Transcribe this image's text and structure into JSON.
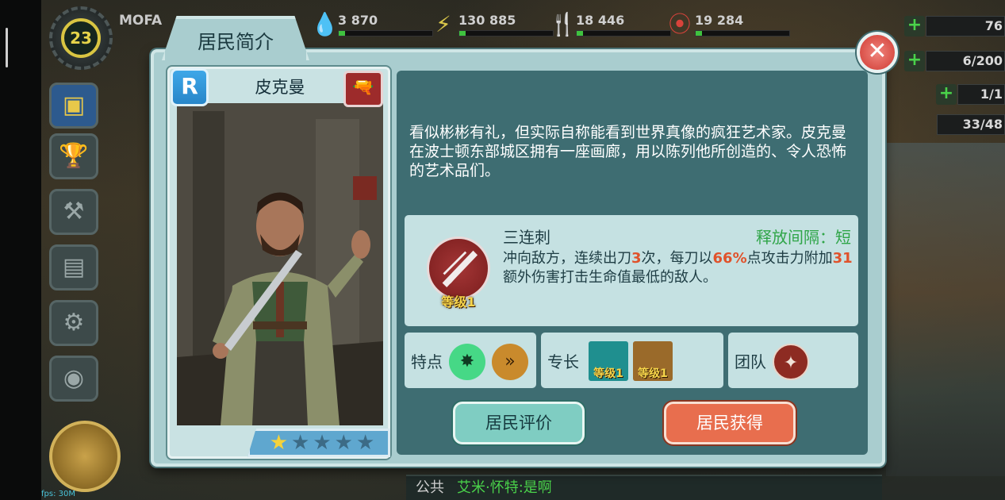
{
  "hud": {
    "level": "23",
    "vault_name": "MOFA",
    "resources": [
      {
        "icon": "water-drop-icon",
        "value": "3 870"
      },
      {
        "icon": "lightning-icon",
        "value": "130 885"
      },
      {
        "icon": "fork-knife-icon",
        "value": "18 446"
      },
      {
        "icon": "nuka-cap-icon",
        "value": "19 284"
      }
    ],
    "counters": [
      "76",
      "6/200",
      "1/1",
      "33/48"
    ]
  },
  "modal": {
    "tab_title": "居民简介",
    "dweller_name": "皮克曼",
    "rarity": "R",
    "stars_on": 1,
    "stars_total": 5,
    "description": "看似彬彬有礼，但实际自称能看到世界真像的疯狂艺术家。皮克曼在波士顿东部城区拥有一座画廊，用以陈列他所创造的、令人恐怖的艺术品们。",
    "skill": {
      "name": "三连刺",
      "cooldown": "释放间隔：短",
      "level": "等级1",
      "desc_p1": "冲向敌方，连续出刀",
      "hits": "3",
      "desc_p2": "次，每刀以",
      "percent": "66%",
      "desc_p3": "点攻击力附加",
      "extra": "31",
      "desc_p4": "额外伤害打击生命值最低的敌人。"
    },
    "traits_label": "特点",
    "specialty_label": "专长",
    "specialty_levels": [
      "等级1",
      "等级1"
    ],
    "team_label": "团队",
    "review_button": "居民评价",
    "obtain_button": "居民获得"
  },
  "chat": {
    "channel": "公共",
    "message": "艾米·怀特:是啊"
  },
  "fps": "fps: 30M",
  "colors": {
    "modal_bg": "#a9cdcf",
    "info_panel": "#3e6d72",
    "highlight": "#e0522b",
    "cooldown_green": "#2fa548",
    "rarity_blue": "#2786c9",
    "obtain_orange": "#e86e4e"
  }
}
